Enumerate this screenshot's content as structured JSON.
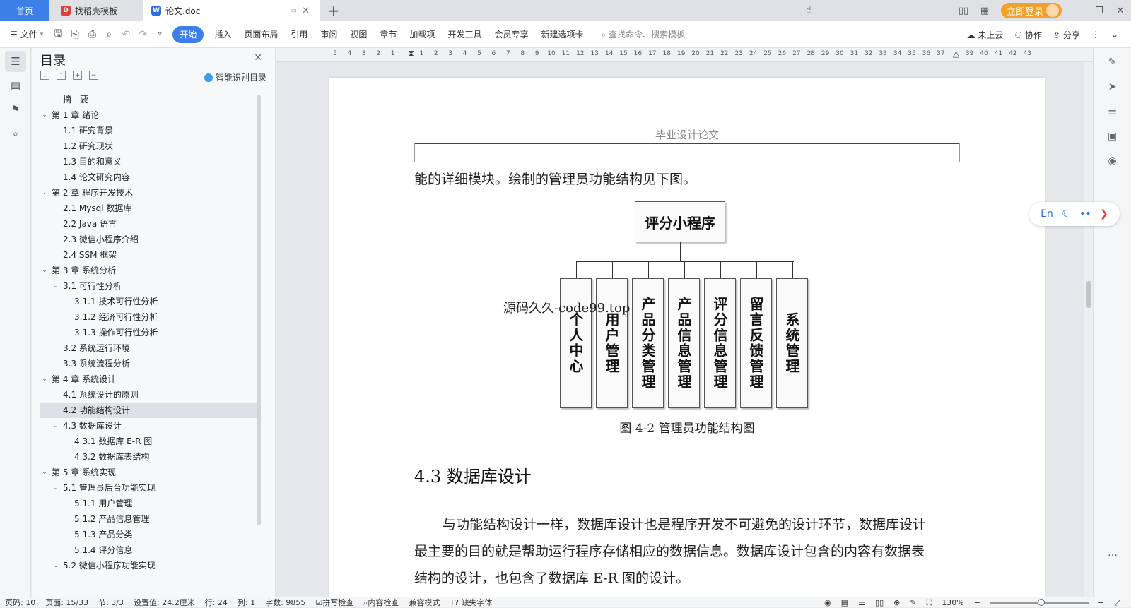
{
  "tabs": {
    "home": "首页",
    "template": "找稻壳模板",
    "doc": "论文.doc",
    "new_tab": "+"
  },
  "window": {
    "login": "立即登录"
  },
  "ribbon": {
    "file": "文件",
    "active": "开始",
    "items": [
      "插入",
      "页面布局",
      "引用",
      "审阅",
      "视图",
      "章节",
      "加载项",
      "开发工具",
      "会员专享",
      "新建选项卡"
    ],
    "search_placeholder": "查找命令、搜索模板",
    "cloud": "未上云",
    "collab": "协作",
    "share": "分享"
  },
  "toc": {
    "title": "目录",
    "smart": "智能识别目录",
    "items": [
      {
        "text": "摘　要",
        "level": 1,
        "chevron": false,
        "selected": false
      },
      {
        "text": "第 1 章  绪论",
        "level": 0,
        "chevron": true,
        "selected": false
      },
      {
        "text": "1.1  研究背景",
        "level": 1,
        "chevron": false,
        "selected": false
      },
      {
        "text": "1.2  研究现状",
        "level": 1,
        "chevron": false,
        "selected": false
      },
      {
        "text": "1.3  目的和意义",
        "level": 1,
        "chevron": false,
        "selected": false
      },
      {
        "text": "1.4  论文研究内容",
        "level": 1,
        "chevron": false,
        "selected": false
      },
      {
        "text": "第 2 章  程序开发技术",
        "level": 0,
        "chevron": true,
        "selected": false
      },
      {
        "text": "2.1 Mysql 数据库",
        "level": 1,
        "chevron": false,
        "selected": false
      },
      {
        "text": "2.2 Java 语言",
        "level": 1,
        "chevron": false,
        "selected": false
      },
      {
        "text": "2.3  微信小程序介绍",
        "level": 1,
        "chevron": false,
        "selected": false
      },
      {
        "text": "2.4 SSM 框架",
        "level": 1,
        "chevron": false,
        "selected": false
      },
      {
        "text": "第 3 章  系统分析",
        "level": 0,
        "chevron": true,
        "selected": false
      },
      {
        "text": "3.1 可行性分析",
        "level": 1,
        "chevron": true,
        "selected": false
      },
      {
        "text": "3.1.1 技术可行性分析",
        "level": 2,
        "chevron": false,
        "selected": false
      },
      {
        "text": "3.1.2 经济可行性分析",
        "level": 2,
        "chevron": false,
        "selected": false
      },
      {
        "text": "3.1.3 操作可行性分析",
        "level": 2,
        "chevron": false,
        "selected": false
      },
      {
        "text": "3.2 系统运行环境",
        "level": 1,
        "chevron": false,
        "selected": false
      },
      {
        "text": "3.3 系统流程分析",
        "level": 1,
        "chevron": false,
        "selected": false
      },
      {
        "text": "第 4 章  系统设计",
        "level": 0,
        "chevron": true,
        "selected": false
      },
      {
        "text": "4.1  系统设计的原则",
        "level": 1,
        "chevron": false,
        "selected": false
      },
      {
        "text": "4.2  功能结构设计",
        "level": 1,
        "chevron": false,
        "selected": true
      },
      {
        "text": "4.3  数据库设计",
        "level": 1,
        "chevron": true,
        "selected": false
      },
      {
        "text": "4.3.1  数据库 E-R 图",
        "level": 2,
        "chevron": false,
        "selected": false
      },
      {
        "text": "4.3.2  数据库表结构",
        "level": 2,
        "chevron": false,
        "selected": false
      },
      {
        "text": "第 5 章  系统实现",
        "level": 0,
        "chevron": true,
        "selected": false
      },
      {
        "text": "5.1 管理员后台功能实现",
        "level": 1,
        "chevron": true,
        "selected": false
      },
      {
        "text": "5.1.1  用户管理",
        "level": 2,
        "chevron": false,
        "selected": false
      },
      {
        "text": "5.1.2  产品信息管理",
        "level": 2,
        "chevron": false,
        "selected": false
      },
      {
        "text": "5.1.3  产品分类",
        "level": 2,
        "chevron": false,
        "selected": false
      },
      {
        "text": "5.1.4  评分信息",
        "level": 2,
        "chevron": false,
        "selected": false
      },
      {
        "text": "5.2  微信小程序功能实现",
        "level": 1,
        "chevron": true,
        "selected": false
      }
    ]
  },
  "ruler": {
    "ticks": [
      "5",
      "4",
      "3",
      "2",
      "1",
      "",
      "1",
      "2",
      "3",
      "4",
      "5",
      "6",
      "7",
      "8",
      "9",
      "10",
      "11",
      "12",
      "13",
      "14",
      "15",
      "16",
      "17",
      "18",
      "19",
      "20",
      "21",
      "22",
      "23",
      "24",
      "25",
      "26",
      "27",
      "28",
      "29",
      "30",
      "31",
      "32",
      "33",
      "34",
      "35",
      "36",
      "37",
      "",
      "39",
      "40",
      "41",
      "42",
      "43"
    ]
  },
  "document": {
    "header": "毕业设计论文",
    "intro": "能的详细模块。绘制的管理员功能结构见下图。",
    "diagram": {
      "root": "评分小程序",
      "children": [
        "个人中心",
        "用户管理",
        "产品分类管理",
        "产品信息管理",
        "评分信息管理",
        "留言反馈管理",
        "系统管理"
      ]
    },
    "watermark": "源码久久-code99.top",
    "caption": "图 4-2  管理员功能结构图",
    "section": "4.3  数据库设计",
    "body1": "与功能结构设计一样，数据库设计也是程序开发不可避免的设计环节，数据库设计",
    "body2": "最主要的目的就是帮助运行程序存储相应的数据信息。数据库设计包含的内容有数据表",
    "body3": "结构的设计，也包含了数据库 E-R 图的设计。"
  },
  "float_pill": {
    "lang": "En"
  },
  "status": {
    "page_no": "页码: 10",
    "page": "页面: 15/33",
    "section": "节: 3/3",
    "setting": "设置值: 24.2厘米",
    "row": "行: 24",
    "col": "列: 1",
    "words": "字数: 9855",
    "spell": "拼写检查",
    "content_check": "内容检查",
    "compat": "兼容模式",
    "missing_font": "缺失字体",
    "zoom": "130%"
  }
}
